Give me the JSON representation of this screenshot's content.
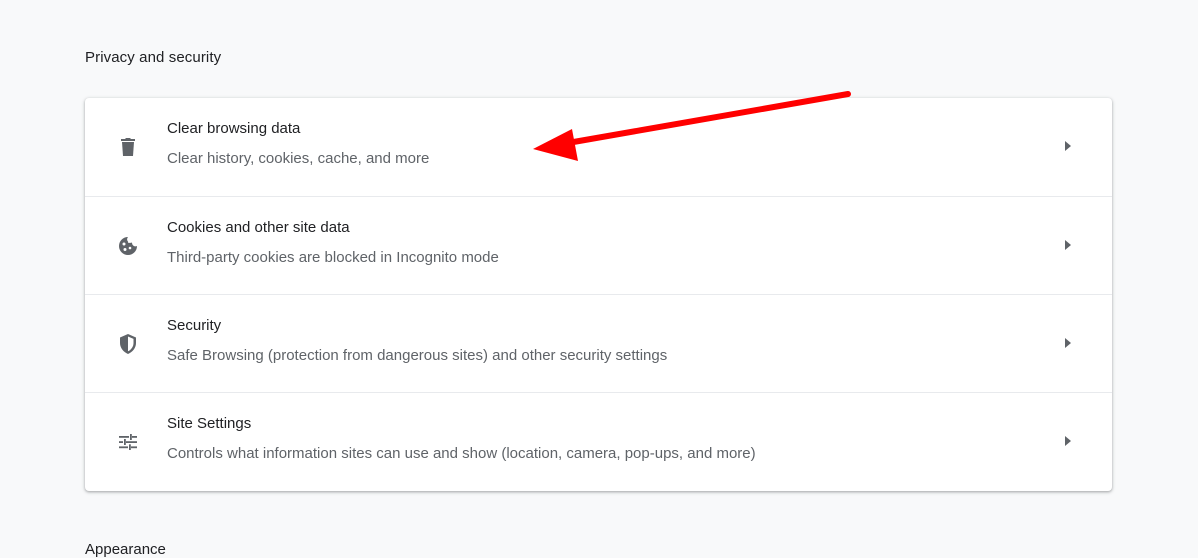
{
  "section": {
    "title": "Privacy and security"
  },
  "rows": [
    {
      "icon": "trash-icon",
      "title": "Clear browsing data",
      "subtitle": "Clear history, cookies, cache, and more"
    },
    {
      "icon": "cookie-icon",
      "title": "Cookies and other site data",
      "subtitle": "Third-party cookies are blocked in Incognito mode"
    },
    {
      "icon": "shield-icon",
      "title": "Security",
      "subtitle": "Safe Browsing (protection from dangerous sites) and other security settings"
    },
    {
      "icon": "tune-icon",
      "title": "Site Settings",
      "subtitle": "Controls what information sites can use and show (location, camera, pop-ups, and more)"
    }
  ],
  "next_section": {
    "title": "Appearance"
  },
  "colors": {
    "annotation_arrow": "#ff0000"
  }
}
